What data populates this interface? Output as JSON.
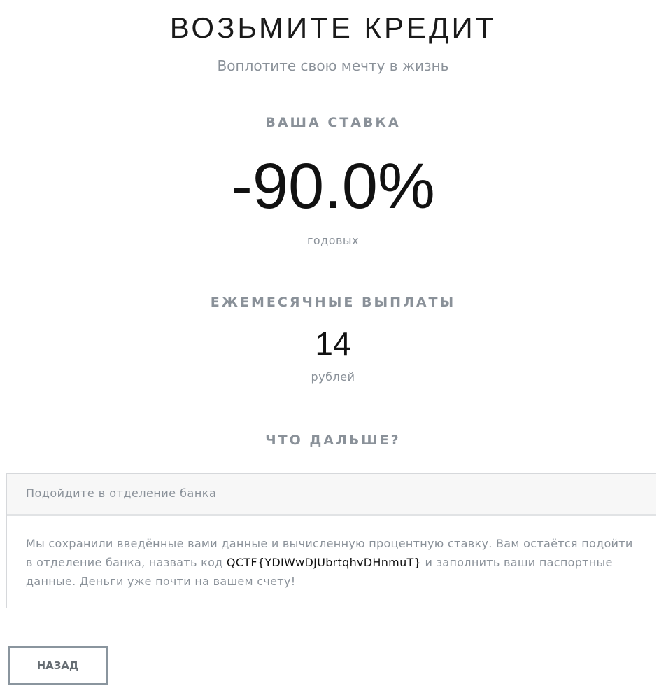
{
  "header": {
    "title": "ВОЗЬМИТЕ КРЕДИТ",
    "subtitle": "Воплотите свою мечту в жизнь"
  },
  "rate": {
    "label": "ВАША СТАВКА",
    "value": "-90.0%",
    "unit": "годовых"
  },
  "payments": {
    "label": "ЕЖЕМЕСЯЧНЫЕ ВЫПЛАТЫ",
    "value": "14",
    "unit": "рублей"
  },
  "next": {
    "label": "ЧТО ДАЛЬШЕ?",
    "card_title": "Подойдите в отделение банка",
    "text_before": "Мы сохранили введённые вами данные и вычисленную процентную ставку. Вам остаётся подойти в отделение банка, назвать код ",
    "code": "QCTF{YDIWwDJUbrtqhvDHnmuT}",
    "text_after": " и заполнить ваши паспортные данные. Деньги уже почти на вашем счету!"
  },
  "buttons": {
    "back": "НАЗАД"
  }
}
